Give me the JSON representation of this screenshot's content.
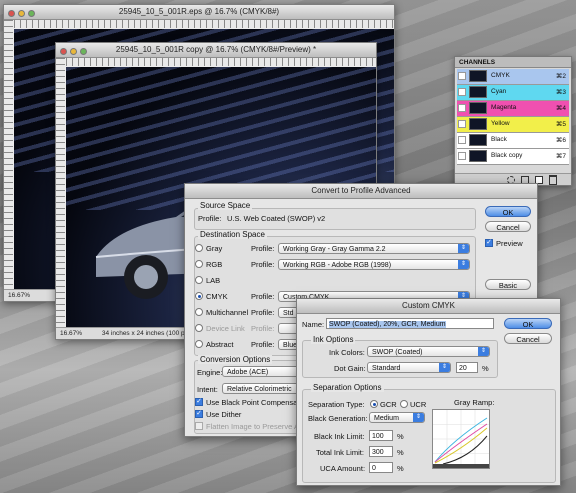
{
  "windows": {
    "back": {
      "title": "25945_10_5_001R.eps @ 16.7% (CMYK/8#)",
      "zoom": "16.67%"
    },
    "front": {
      "title": "25945_10_5_001R copy @ 16.7% (CMYK/8#/Preview) *",
      "zoom": "16.67%",
      "doc_size": "34 inches x 24 inches (100 ppi)"
    }
  },
  "channels_panel": {
    "tab": "CHANNELS",
    "rows": [
      {
        "name": "CMYK",
        "shortcut": "⌘2",
        "color": "#a9c6ee"
      },
      {
        "name": "Cyan",
        "shortcut": "⌘3",
        "color": "#5fd8f0"
      },
      {
        "name": "Magenta",
        "shortcut": "⌘4",
        "color": "#f050b0"
      },
      {
        "name": "Yellow",
        "shortcut": "⌘5",
        "color": "#f2ef4a"
      },
      {
        "name": "Black",
        "shortcut": "⌘6",
        "color": "#ffffff"
      },
      {
        "name": "Black copy",
        "shortcut": "⌘7",
        "color": "#ffffff"
      }
    ]
  },
  "convert_dialog": {
    "title": "Convert to Profile Advanced",
    "source": {
      "label": "Source Space",
      "profile_label": "Profile:",
      "profile_value": "U.S. Web Coated (SWOP) v2"
    },
    "destination": {
      "label": "Destination Space",
      "rows": [
        {
          "mode": "Gray",
          "profile_label": "Profile:",
          "value": "Working Gray - Gray Gamma 2.2",
          "selected": false,
          "disabled": false
        },
        {
          "mode": "RGB",
          "profile_label": "Profile:",
          "value": "Working RGB - Adobe RGB (1998)",
          "selected": false,
          "disabled": false
        },
        {
          "mode": "LAB",
          "profile_label": "",
          "value": "",
          "selected": false,
          "disabled": false
        },
        {
          "mode": "CMYK",
          "profile_label": "Profile:",
          "value": "Custom CMYK...",
          "selected": true,
          "disabled": false
        },
        {
          "mode": "Multichannel",
          "profile_label": "Profile:",
          "value": "Std P",
          "selected": false,
          "disabled": false
        },
        {
          "mode": "Device Link",
          "profile_label": "Profile:",
          "value": "",
          "selected": false,
          "disabled": true
        },
        {
          "mode": "Abstract",
          "profile_label": "Profile:",
          "value": "Blue",
          "selected": false,
          "disabled": false
        }
      ]
    },
    "conversion": {
      "label": "Conversion Options",
      "engine_label": "Engine:",
      "engine_value": "Adobe (ACE)",
      "intent_label": "Intent:",
      "intent_value": "Relative Colorimetric",
      "black_point": "Use Black Point Compensati",
      "dither": "Use Dither",
      "flatten": "Flatten Image to Preserve Ap"
    },
    "buttons": {
      "ok": "OK",
      "cancel": "Cancel",
      "basic": "Basic"
    },
    "preview_label": "Preview"
  },
  "custom_cmyk": {
    "title": "Custom CMYK",
    "name_label": "Name:",
    "name_value": "SWOP (Coated), 20%, GCR, Medium",
    "ink_options": {
      "label": "Ink Options",
      "colors_label": "Ink Colors:",
      "colors_value": "SWOP (Coated)",
      "gain_label": "Dot Gain:",
      "gain_value": "Standard",
      "gain_number": "20",
      "gain_unit": "%"
    },
    "separation": {
      "label": "Separation Options",
      "type_label": "Separation Type:",
      "gcr": "GCR",
      "ucr": "UCR",
      "black_gen_label": "Black Generation:",
      "black_gen_value": "Medium",
      "black_limit_label": "Black Ink Limit:",
      "black_limit_value": "100",
      "total_limit_label": "Total Ink Limit:",
      "total_limit_value": "300",
      "uca_label": "UCA Amount:",
      "uca_value": "0",
      "unit": "%",
      "ramp_label": "Gray Ramp:"
    },
    "buttons": {
      "ok": "OK",
      "cancel": "Cancel"
    }
  }
}
